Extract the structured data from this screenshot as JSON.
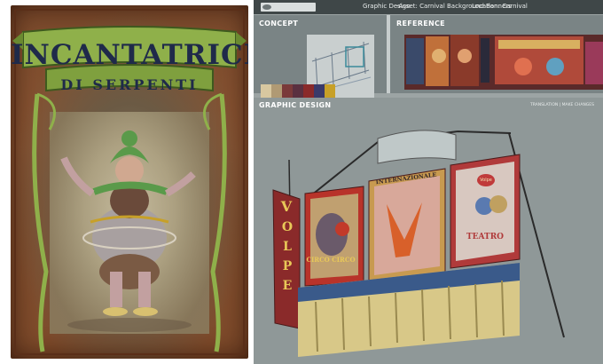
{
  "poster": {
    "title": "INCANTATRICE",
    "subtitle": "DI SERPENTI"
  },
  "header": {
    "label1": "Graphic Design",
    "label2": "-Asset:  Carnival Background Banners",
    "label3": "Location:  Carnival"
  },
  "sections": {
    "concept": "CONCEPT",
    "reference": "REFERENCE",
    "graphic_design": "GRAPHIC DESIGN",
    "translation": "TRANSLATION  |  MAKE CHANGES"
  },
  "palette": [
    "#d8c8a0",
    "#b09a74",
    "#7a3a3a",
    "#5a3040",
    "#8a2a2a",
    "#3a3a6a",
    "#c7a028"
  ],
  "scene": {
    "banner1_text": "CIRCO CIRCO",
    "banner2_text": "INTERNAZIONALE",
    "banner3_text": "TEATRO",
    "sign_text": "VOLPE",
    "badge_text": "Volpe"
  }
}
